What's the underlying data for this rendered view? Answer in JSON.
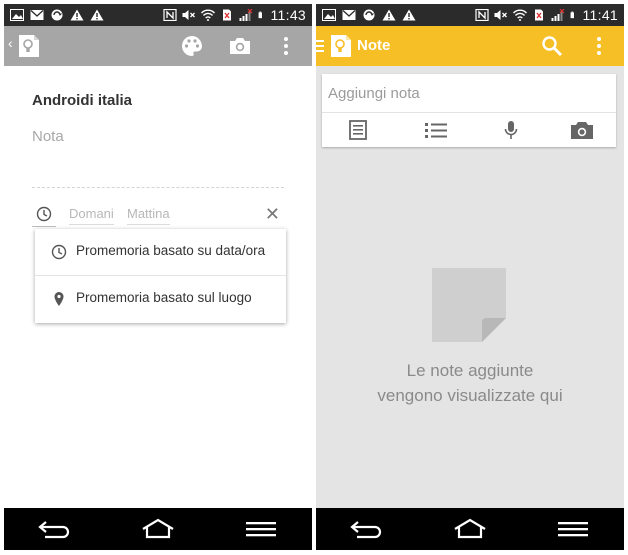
{
  "colors": {
    "status_bar": "#2b2b2b",
    "nav_bar": "#000000",
    "edit_toolbar": "#a6a6a6",
    "keep_yellow": "#f6bf26",
    "list_background": "#e4e4e4"
  },
  "left_phone": {
    "status_bar": {
      "left_icons": [
        "image-icon",
        "mail-icon",
        "sync-icon",
        "warning-icon",
        "warning-icon"
      ],
      "right_icons": [
        "nfc-icon",
        "mute-icon",
        "wifi-icon",
        "no-sim-icon",
        "signal-icon",
        "battery-icon"
      ],
      "time": "11:43"
    },
    "toolbar": {
      "icons": [
        "back-chevron-icon",
        "keep-app-icon",
        "palette-icon",
        "camera-icon",
        "overflow-menu-icon"
      ]
    },
    "note": {
      "title": "Androidi italia",
      "body_placeholder": "Nota"
    },
    "reminder": {
      "date": "Domani",
      "time": "Mattina",
      "icons": [
        "clock-icon",
        "close-icon"
      ]
    },
    "reminder_menu": [
      {
        "label": "Promemoria basato su data/ora",
        "icon": "clock-icon"
      },
      {
        "label": "Promemoria basato sul luogo",
        "icon": "location-pin-icon"
      }
    ],
    "nav_bar": {
      "icons": [
        "back-icon",
        "home-icon",
        "menu-icon"
      ]
    }
  },
  "right_phone": {
    "status_bar": {
      "left_icons": [
        "image-icon",
        "mail-icon",
        "sync-icon",
        "warning-icon",
        "warning-icon"
      ],
      "right_icons": [
        "nfc-icon",
        "mute-icon",
        "wifi-icon",
        "no-sim-icon",
        "signal-icon",
        "battery-icon"
      ],
      "time": "11:41"
    },
    "toolbar": {
      "title": "Note",
      "icons": [
        "drawer-icon",
        "keep-logo-icon",
        "search-icon",
        "overflow-menu-icon"
      ]
    },
    "add_note": {
      "placeholder": "Aggiungi nota",
      "actions": [
        "text-note-icon",
        "checklist-icon",
        "microphone-icon",
        "camera-icon"
      ]
    },
    "empty_state": {
      "line1": "Le note aggiunte",
      "line2": "vengono visualizzate qui",
      "icon": "note-paper-icon"
    },
    "nav_bar": {
      "icons": [
        "back-icon",
        "home-icon",
        "menu-icon"
      ]
    }
  }
}
